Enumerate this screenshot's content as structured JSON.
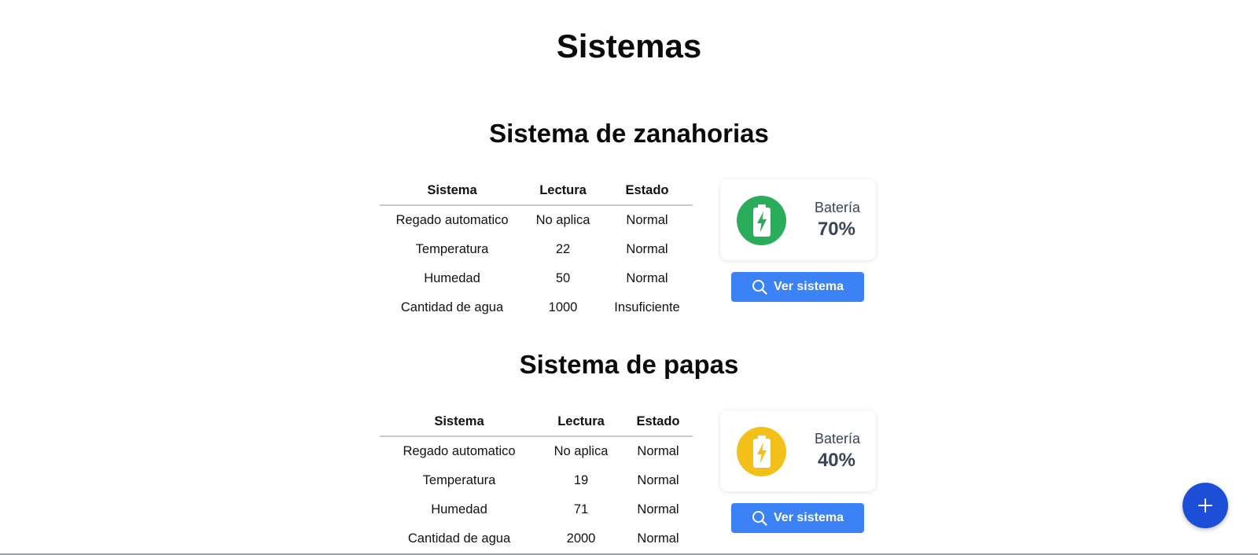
{
  "page": {
    "title": "Sistemas"
  },
  "colors": {
    "battery_high": "#2aac5b",
    "battery_mid": "#f2c018",
    "button": "#3b82f6",
    "fab": "#1d4ed8"
  },
  "systems": [
    {
      "title": "Sistema de zanahorias",
      "headers": [
        "Sistema",
        "Lectura",
        "Estado"
      ],
      "rows": [
        [
          "Regado automatico",
          "No aplica",
          "Normal"
        ],
        [
          "Temperatura",
          "22",
          "Normal"
        ],
        [
          "Humedad",
          "50",
          "Normal"
        ],
        [
          "Cantidad de agua",
          "1000",
          "Insuficiente"
        ]
      ],
      "battery": {
        "label": "Batería",
        "value": "70%",
        "icon": "battery-charging-icon"
      },
      "button": {
        "label": "Ver sistema",
        "icon": "search-icon"
      }
    },
    {
      "title": "Sistema de papas",
      "headers": [
        "Sistema",
        "Lectura",
        "Estado"
      ],
      "rows": [
        [
          "Regado automatico",
          "No aplica",
          "Normal"
        ],
        [
          "Temperatura",
          "19",
          "Normal"
        ],
        [
          "Humedad",
          "71",
          "Normal"
        ],
        [
          "Cantidad de agua",
          "2000",
          "Normal"
        ]
      ],
      "battery": {
        "label": "Batería",
        "value": "40%",
        "icon": "battery-charging-icon"
      },
      "button": {
        "label": "Ver sistema",
        "icon": "search-icon"
      }
    }
  ],
  "fab": {
    "icon": "plus-icon"
  }
}
